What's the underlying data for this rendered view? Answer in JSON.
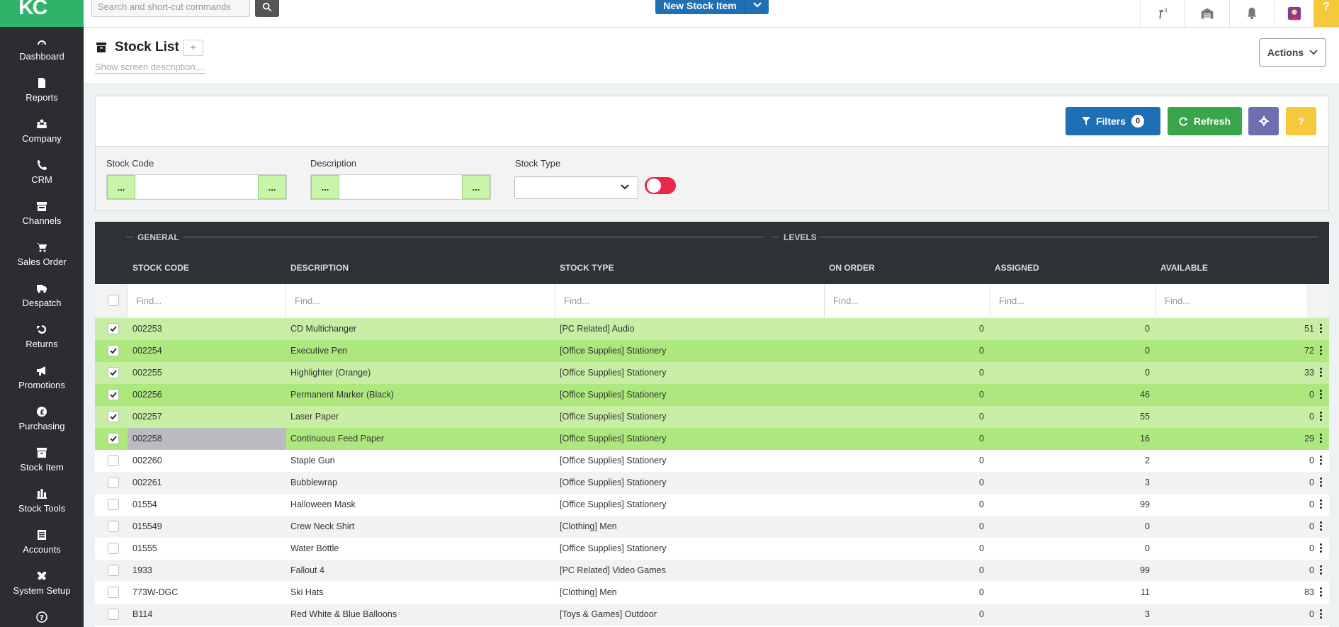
{
  "app": {
    "logo": "KC"
  },
  "sidebar": {
    "items": [
      {
        "label": "Dashboard",
        "icon": "gauge-icon"
      },
      {
        "label": "Reports",
        "icon": "file-icon"
      },
      {
        "label": "Company",
        "icon": "company-icon"
      },
      {
        "label": "CRM",
        "icon": "phone-icon"
      },
      {
        "label": "Channels",
        "icon": "store-icon"
      },
      {
        "label": "Sales Order",
        "icon": "cart-icon"
      },
      {
        "label": "Despatch",
        "icon": "truck-icon"
      },
      {
        "label": "Returns",
        "icon": "returns-icon"
      },
      {
        "label": "Promotions",
        "icon": "megaphone-icon"
      },
      {
        "label": "Purchasing",
        "icon": "pound-icon"
      },
      {
        "label": "Stock Item",
        "icon": "box-icon"
      },
      {
        "label": "Stock Tools",
        "icon": "chart-icon"
      },
      {
        "label": "Accounts",
        "icon": "ledger-icon"
      },
      {
        "label": "System Setup",
        "icon": "tools-icon"
      },
      {
        "label": "",
        "icon": "help-circle-icon"
      }
    ]
  },
  "topbar": {
    "search_placeholder": "Search and short-cut commands",
    "new_stock_label": "New Stock Item",
    "help_label": "?"
  },
  "header": {
    "title": "Stock List",
    "plus": "+",
    "screen_description": "Show screen description....",
    "actions_label": "Actions"
  },
  "panel": {
    "filters_label": "Filters",
    "filters_count": "0",
    "refresh_label": "Refresh",
    "help_label": "?",
    "stock_code_label": "Stock Code",
    "description_label": "Description",
    "stock_type_label": "Stock Type",
    "lookup_dots": "..."
  },
  "grid": {
    "groups": {
      "general": "GENERAL",
      "levels": "LEVELS"
    },
    "columns": [
      "STOCK CODE",
      "DESCRIPTION",
      "STOCK TYPE",
      "ON ORDER",
      "ASSIGNED",
      "AVAILABLE"
    ],
    "find_placeholder": "Find...",
    "rows": [
      {
        "code": "002253",
        "desc": "CD Multichanger",
        "type": "[PC Related] Audio",
        "on_order": "0",
        "assigned": "0",
        "available": "51",
        "checked": true
      },
      {
        "code": "002254",
        "desc": "Executive Pen",
        "type": "[Office Supplies] Stationery",
        "on_order": "0",
        "assigned": "0",
        "available": "72",
        "checked": true
      },
      {
        "code": "002255",
        "desc": "Highlighter (Orange)",
        "type": "[Office Supplies] Stationery",
        "on_order": "0",
        "assigned": "0",
        "available": "33",
        "checked": true
      },
      {
        "code": "002256",
        "desc": "Permanent Marker (Black)",
        "type": "[Office Supplies] Stationery",
        "on_order": "0",
        "assigned": "46",
        "available": "0",
        "checked": true
      },
      {
        "code": "002257",
        "desc": "Laser Paper",
        "type": "[Office Supplies] Stationery",
        "on_order": "0",
        "assigned": "55",
        "available": "0",
        "checked": true
      },
      {
        "code": "002258",
        "desc": "Continuous Feed Paper",
        "type": "[Office Supplies] Stationery",
        "on_order": "0",
        "assigned": "16",
        "available": "29",
        "checked": true
      },
      {
        "code": "002260",
        "desc": "Staple Gun",
        "type": "[Office Supplies] Stationery",
        "on_order": "0",
        "assigned": "2",
        "available": "0",
        "checked": false
      },
      {
        "code": "002261",
        "desc": "Bubblewrap",
        "type": "[Office Supplies] Stationery",
        "on_order": "0",
        "assigned": "3",
        "available": "0",
        "checked": false
      },
      {
        "code": "01554",
        "desc": "Halloween Mask",
        "type": "[Office Supplies] Stationery",
        "on_order": "0",
        "assigned": "99",
        "available": "0",
        "checked": false
      },
      {
        "code": "015549",
        "desc": "Crew Neck Shirt",
        "type": "[Clothing] Men",
        "on_order": "0",
        "assigned": "0",
        "available": "0",
        "checked": false
      },
      {
        "code": "01555",
        "desc": "Water Bottle",
        "type": "[Office Supplies] Stationery",
        "on_order": "0",
        "assigned": "0",
        "available": "0",
        "checked": false
      },
      {
        "code": "1933",
        "desc": "Fallout 4",
        "type": "[PC Related] Video Games",
        "on_order": "0",
        "assigned": "99",
        "available": "0",
        "checked": false
      },
      {
        "code": "773W-DGC",
        "desc": "Ski Hats",
        "type": "[Clothing] Men",
        "on_order": "0",
        "assigned": "11",
        "available": "83",
        "checked": false
      },
      {
        "code": "B114",
        "desc": "Red White & Blue Balloons",
        "type": "[Toys & Games] Outdoor",
        "on_order": "0",
        "assigned": "3",
        "available": "0",
        "checked": false
      }
    ]
  },
  "colors": {
    "sidebar": "#2b2d31",
    "brand_green": "#2fb36b",
    "primary_blue": "#1f6fb5",
    "refresh_green": "#3aa54a",
    "settings_purple": "#6d6fb0",
    "help_yellow": "#f5c93b",
    "row_selected_light": "#c8eea5",
    "row_selected_dark": "#ade87e",
    "toggle_red": "#e8274b"
  }
}
